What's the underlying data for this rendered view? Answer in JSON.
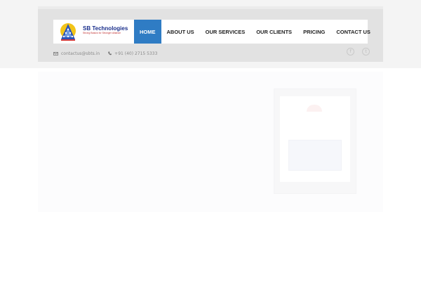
{
  "brand": {
    "name": "SB Technologies",
    "tagline": "Strong Basics for Stronger Alliance"
  },
  "nav": {
    "items": [
      {
        "label": "HOME",
        "active": true
      },
      {
        "label": "ABOUT US",
        "active": false
      },
      {
        "label": "OUR SERVICES",
        "active": false
      },
      {
        "label": "OUR CLIENTS",
        "active": false
      },
      {
        "label": "PRICING",
        "active": false
      },
      {
        "label": "CONTACT US",
        "active": false
      }
    ]
  },
  "contact": {
    "email": "contactus@sbts.in",
    "phone": "+91 (40) 2715 5333"
  },
  "social": [
    {
      "icon": "facebook-icon",
      "glyph": "f"
    },
    {
      "icon": "twitter-icon",
      "glyph": "t"
    }
  ],
  "colors": {
    "accent": "#2f7cc4",
    "brand": "#1a2f8c",
    "header_bg": "#e2e2e2"
  }
}
